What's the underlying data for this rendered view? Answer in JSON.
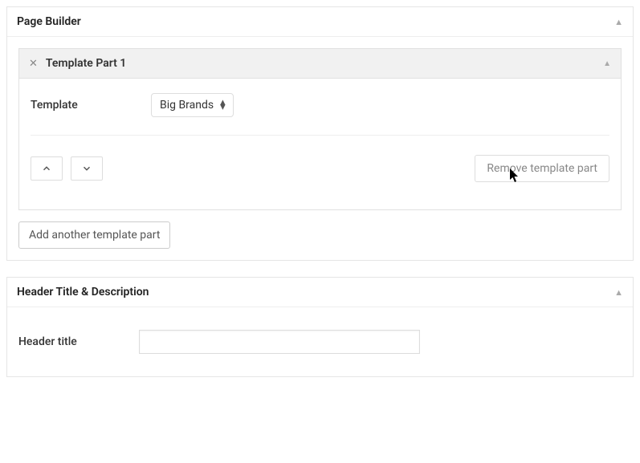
{
  "page_builder": {
    "title": "Page Builder",
    "template_part": {
      "title": "Template Part 1",
      "field_label": "Template",
      "selected_value": "Big Brands",
      "remove_label": "Remove template part"
    },
    "add_label": "Add another template part"
  },
  "header_section": {
    "title": "Header Title & Description",
    "field_label": "Header title",
    "value": ""
  }
}
